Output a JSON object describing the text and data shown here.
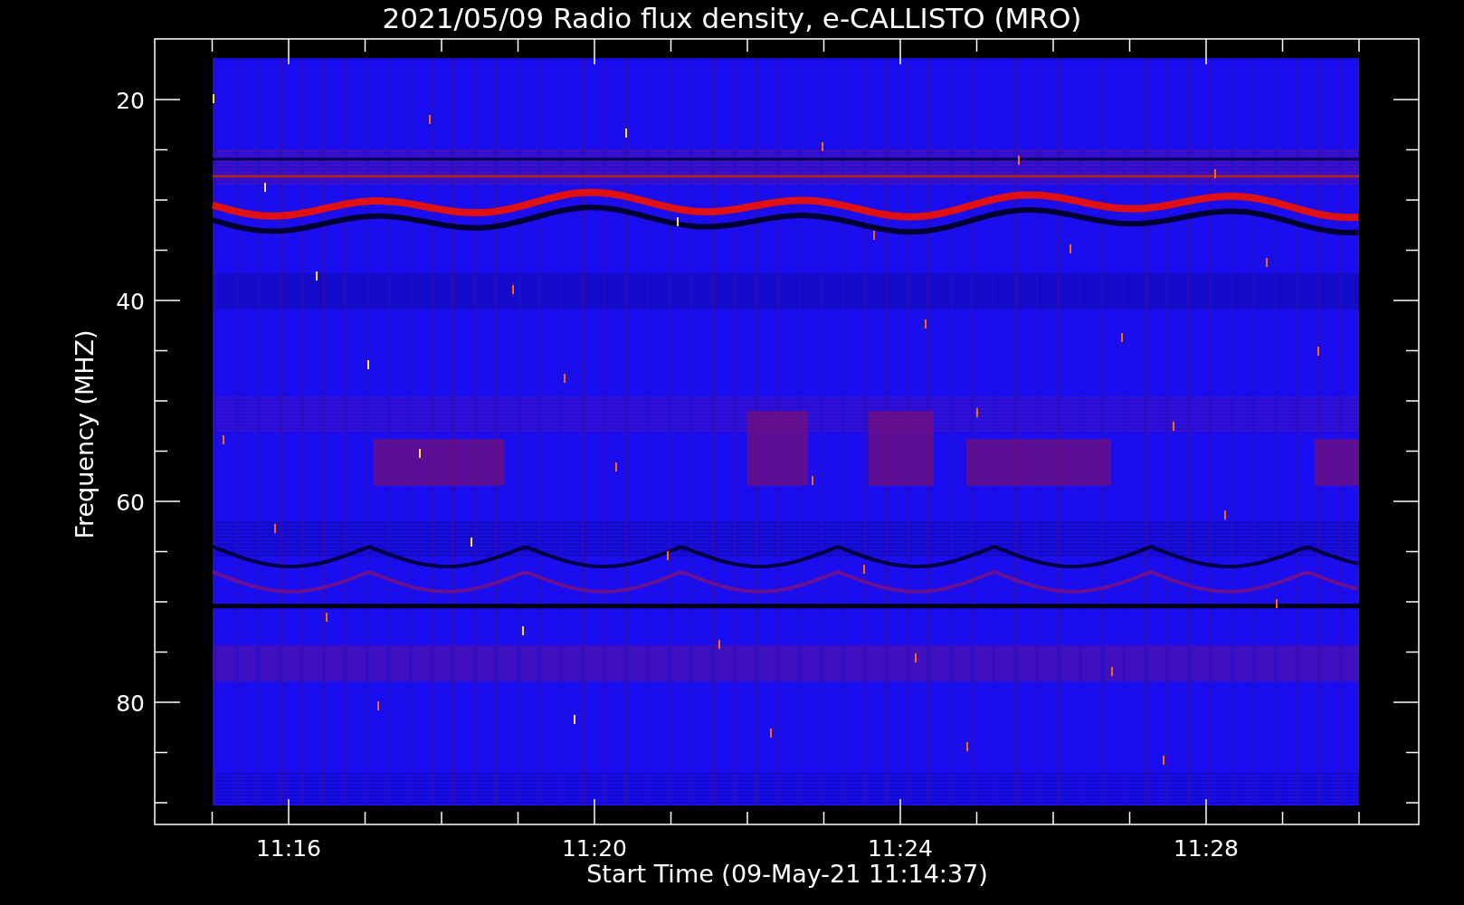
{
  "plot": {
    "title": "2021/05/09  Radio flux density, e-CALLISTO (MRO)",
    "y_axis": {
      "label": "Frequency (MHZ)",
      "ticks": [
        "20",
        "40",
        "60",
        "80"
      ]
    },
    "x_axis": {
      "label": "Start Time (09-May-21 11:14:37)",
      "ticks": [
        "11:16",
        "11:20",
        "11:24",
        "11:28"
      ]
    }
  }
}
